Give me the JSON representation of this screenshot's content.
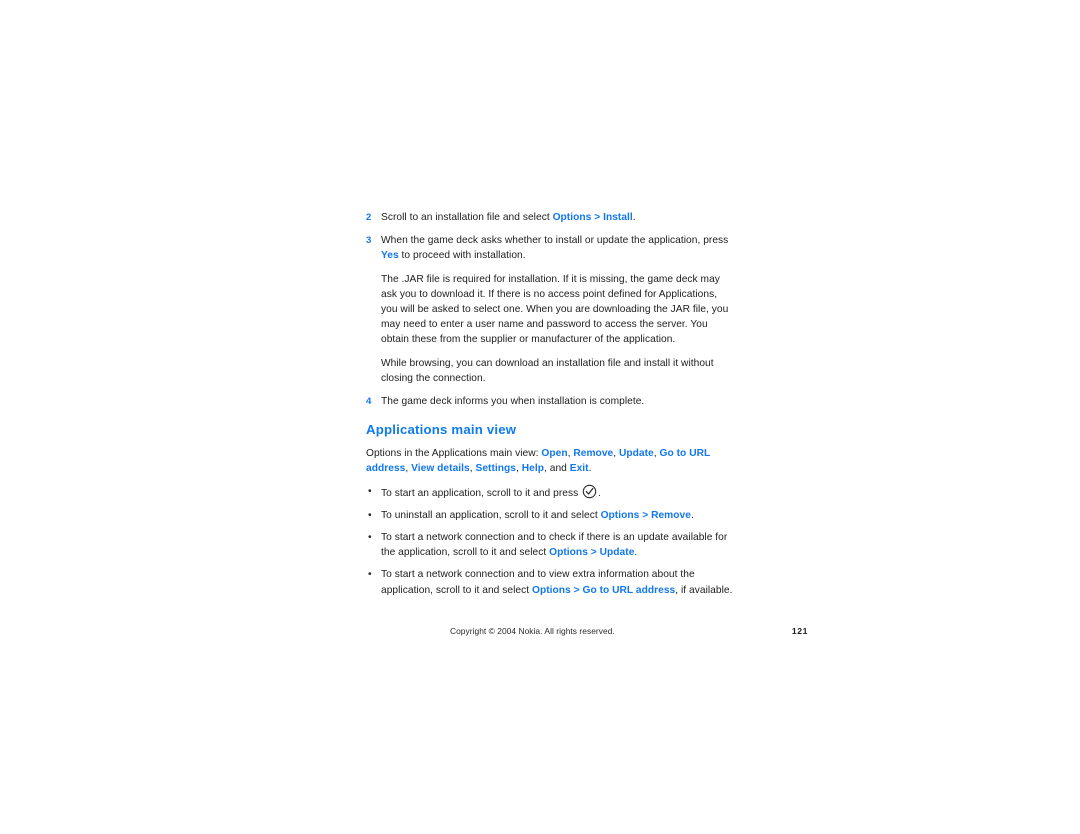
{
  "document": {
    "title": "Applications main view",
    "page_number": "121",
    "accent_color": "#1277ee",
    "heading_color": "#0d7bf0",
    "text_color": "#1d1d1d",
    "background_color": "#ffffff"
  },
  "steps": [
    {
      "number": "2",
      "text_before": "Scroll to an installation file and select ",
      "ui_term": "Options > Install",
      "text_after": "."
    },
    {
      "number": "3",
      "line1_before": "When the game deck asks whether to install or update the application,",
      "line2_before": "press ",
      "ui_term": "Yes",
      "line2_after": " to proceed with installation."
    },
    {
      "number": "4",
      "text_before": "The game deck informs you when installation is complete.",
      "ui_term": "",
      "text_after": ""
    }
  ],
  "paragraphs": {
    "jar_file": "The .JAR file is required for installation. If it is missing, the game deck may ask you to download it. If there is no access point defined for Applications, you will be asked to select one. When you are downloading the JAR file, you may need to enter a user name and password to access the server. You obtain these from the supplier or manufacturer of the application.",
    "browsing": "While browsing, you can download an installation file and install it without closing the connection."
  },
  "intro": {
    "lead": "Options in the Applications main view: ",
    "terms": [
      "Open",
      "Remove",
      "Update",
      "Go to URL address",
      "View details",
      "Settings",
      "Help",
      "Exit"
    ],
    "conjunction": "and",
    "trailing": "."
  },
  "bullets": [
    {
      "text_before": "To start an application, scroll to it and press ",
      "icon": "circled-check-icon",
      "ui_term": "",
      "text_after": "."
    },
    {
      "text_before": "To uninstall an application, scroll to it and select ",
      "icon": "",
      "ui_term": "Options > Remove",
      "text_after": "."
    },
    {
      "text_before": "To start a network connection and to check if there is an update available for the application, scroll to it and select ",
      "icon": "",
      "ui_term": "Options > Update",
      "text_after": "."
    },
    {
      "text_before": "To start a network connection and to view extra information about the application, scroll to it and select ",
      "icon": "",
      "ui_term": "Options > Go to URL address",
      "text_after": ", if available."
    }
  ],
  "footer": {
    "copyright": "Copyright © 2004 Nokia. All rights reserved.",
    "page_number": "121"
  }
}
